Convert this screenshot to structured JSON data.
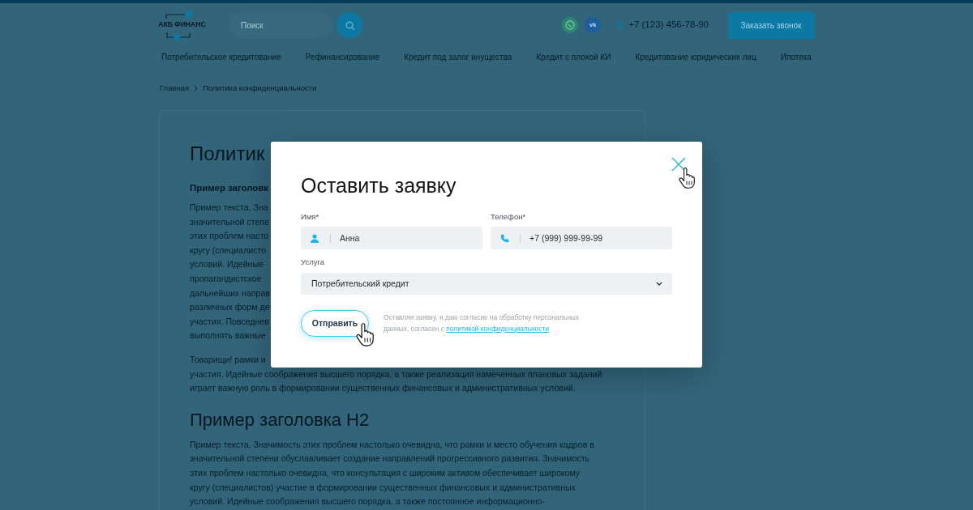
{
  "header": {
    "logo": {
      "text": "АКБ ФИНАНС"
    },
    "search": {
      "placeholder": "Поиск"
    },
    "social_links": [
      {
        "kind": "chat"
      },
      {
        "kind": "label",
        "label": "vk"
      }
    ],
    "phone": "+7 (123) 456-78-90",
    "callback_button": "Заказать звонок"
  },
  "nav": {
    "items": [
      "Потребительское кредитование",
      "Рефинансирование",
      "Кредит под залог инущества",
      "Кредит с плохой КИ",
      "Кредитование юридических лиц",
      "Ипотека"
    ]
  },
  "breadcrumbs": [
    {
      "label": "Главная",
      "kind": "link"
    },
    {
      "label": "Политика конфиденциальности",
      "kind": "current"
    }
  ],
  "article": {
    "blocks": [
      {
        "kind": "h1",
        "text": "Политик"
      },
      {
        "kind": "h3",
        "text": "Пример заголовк"
      },
      {
        "kind": "p",
        "lines": [
          "Пример текста. Зна",
          "значительной степе",
          "этих проблем насто",
          "кругу (специалисто",
          "условий. Идейные",
          "пропагандистское",
          "дальнейших направ",
          "различных форм де",
          "участия. Повседнев",
          "выполнять важные"
        ]
      },
      {
        "kind": "p",
        "lines": [
          "Товарищи! рамки и"
        ]
      },
      {
        "kind": "continuation",
        "lines": [
          "участия. Идейные соображения высшего порядка, а также реализация намеченных плановых заданий",
          "играет важную роль в формировании существенных финансовых и административных условий."
        ]
      },
      {
        "kind": "h2",
        "text": "Пример заголовка H2"
      },
      {
        "kind": "p",
        "lines": [
          "Пример текста. Значимость этих проблем настолько очевидна, что рамки и место обучения кадров в",
          "значительной степени обуславливает создание направлений прогрессивного развития. Значимость",
          "этих проблем настолько очевидна, что консультация с широким активом обеспечивает широкому",
          "кругу (специалистов) участие в формировании существенных финансовых и административных",
          "условий. Идейные соображения высшего порядка, а также постоянное информационно-"
        ]
      }
    ]
  },
  "modal": {
    "title": "Оставить заявку",
    "fields": [
      {
        "kind": "person",
        "label": "Имя*",
        "value": "Анна"
      },
      {
        "kind": "phone",
        "label": "Телефон*",
        "value": "+7 (999) 999-99-99"
      }
    ],
    "service": {
      "label": "Услуга",
      "value": "Потребительский кредит"
    },
    "submit_button": "Отправить",
    "consent": {
      "lines": [
        "Оставляя заявку, я даю согласие на обработку персональных",
        "данных, согласен с"
      ],
      "link": "политикой конфиденциальности"
    }
  }
}
